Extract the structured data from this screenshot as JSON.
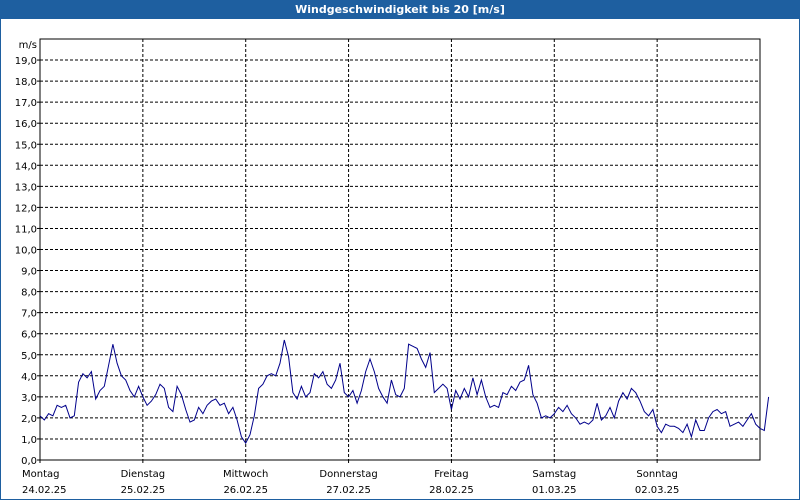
{
  "window": {
    "title": "Windgeschwindigkeit bis 20 [m/s]"
  },
  "chart_data": {
    "type": "line",
    "title": "Windgeschwindigkeit bis 20 [m/s]",
    "ylabel": "m/s",
    "ylim": [
      0,
      20
    ],
    "ytick_labels": [
      "0,0",
      "1,0",
      "2,0",
      "3,0",
      "4,0",
      "5,0",
      "6,0",
      "7,0",
      "8,0",
      "9,0",
      "10,0",
      "11,0",
      "12,0",
      "13,0",
      "14,0",
      "15,0",
      "16,0",
      "17,0",
      "18,0",
      "19,0"
    ],
    "x_days": [
      {
        "day": "Montag",
        "date": "24.02.25"
      },
      {
        "day": "Dienstag",
        "date": "25.02.25"
      },
      {
        "day": "Mittwoch",
        "date": "26.02.25"
      },
      {
        "day": "Donnerstag",
        "date": "27.02.25"
      },
      {
        "day": "Freitag",
        "date": "28.02.25"
      },
      {
        "day": "Samstag",
        "date": "01.03.25"
      },
      {
        "day": "Sonntag",
        "date": "02.03.25"
      }
    ],
    "grid": true,
    "line_color": "#00008b",
    "series": [
      {
        "values_per_day": 24,
        "values": [
          2.1,
          1.9,
          2.2,
          2.1,
          2.6,
          2.5,
          2.6,
          2.0,
          2.1,
          3.7,
          4.1,
          3.9,
          4.2,
          2.9,
          3.3,
          3.5,
          4.5,
          5.5,
          4.6,
          4.0,
          3.8,
          3.3,
          3.0,
          3.5,
          3.0,
          2.6,
          2.8,
          3.1,
          3.6,
          3.4,
          2.5,
          2.3,
          3.5,
          3.1,
          2.4,
          1.8,
          1.9,
          2.5,
          2.2,
          2.6,
          2.8,
          2.9,
          2.6,
          2.7,
          2.2,
          2.5,
          1.9,
          1.1,
          0.8,
          1.2,
          2.1,
          3.4,
          3.6,
          4.0,
          4.1,
          4.0,
          4.6,
          5.7,
          4.9,
          3.2,
          2.9,
          3.5,
          3.0,
          3.2,
          4.1,
          3.9,
          4.2,
          3.6,
          3.4,
          3.8,
          4.6,
          3.2,
          3.0,
          3.3,
          2.7,
          3.3,
          4.2,
          4.8,
          4.2,
          3.4,
          3.0,
          2.7,
          3.8,
          3.1,
          3.0,
          3.4,
          5.5,
          5.4,
          5.3,
          4.8,
          4.4,
          5.1,
          3.2,
          3.4,
          3.6,
          3.4,
          2.4,
          3.3,
          2.9,
          3.4,
          3.0,
          3.9,
          3.1,
          3.8,
          3.0,
          2.5,
          2.6,
          2.5,
          3.2,
          3.1,
          3.5,
          3.3,
          3.7,
          3.8,
          4.5,
          3.1,
          2.7,
          2.0,
          2.1,
          2.0,
          2.2,
          2.5,
          2.3,
          2.6,
          2.2,
          2.0,
          1.7,
          1.8,
          1.7,
          1.9,
          2.7,
          1.9,
          2.1,
          2.5,
          2.0,
          2.8,
          3.2,
          2.9,
          3.4,
          3.2,
          2.8,
          2.3,
          2.1,
          2.4,
          1.6,
          1.3,
          1.7,
          1.6,
          1.6,
          1.5,
          1.3,
          1.7,
          1.1,
          1.9,
          1.4,
          1.4,
          2.0,
          2.3,
          2.4,
          2.2,
          2.3,
          1.6,
          1.7,
          1.8,
          1.6,
          1.9,
          2.2,
          1.7,
          1.5,
          1.4,
          3.0
        ]
      }
    ]
  }
}
